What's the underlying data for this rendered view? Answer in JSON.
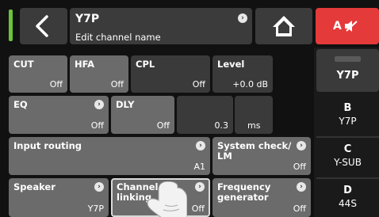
{
  "header": {
    "channel_title": "Y7P",
    "channel_subtitle": "Edit channel name",
    "mute_label": "A",
    "accent_color": "#69c43a",
    "mute_color": "#e43a3a"
  },
  "tiles": {
    "cut": {
      "label": "CUT",
      "value": "Off"
    },
    "hfa": {
      "label": "HFA",
      "value": "Off"
    },
    "cpl": {
      "label": "CPL",
      "value": "Off"
    },
    "level": {
      "label": "Level",
      "value": "+0.0 dB"
    },
    "eq": {
      "label": "EQ",
      "value": "Off"
    },
    "dly": {
      "label": "DLY",
      "value": "Off",
      "amount": "0.3",
      "unit": "ms"
    },
    "input_routing": {
      "label": "Input routing",
      "value": "A1"
    },
    "system_check": {
      "label_line1": "System check/",
      "label_line2": "LM",
      "value": "Off"
    },
    "speaker": {
      "label": "Speaker",
      "value": "Y7P"
    },
    "channel_linking": {
      "label_line1": "Channel",
      "label_line2": "linking",
      "value": "Off"
    },
    "frequency_generator": {
      "label_line1": "Frequency",
      "label_line2": "generator",
      "value": "Off"
    }
  },
  "channels": [
    {
      "big": "Y7P",
      "small": ""
    },
    {
      "big": "B",
      "small": "Y7P"
    },
    {
      "big": "C",
      "small": "Y-SUB"
    },
    {
      "big": "D",
      "small": "44S"
    }
  ]
}
